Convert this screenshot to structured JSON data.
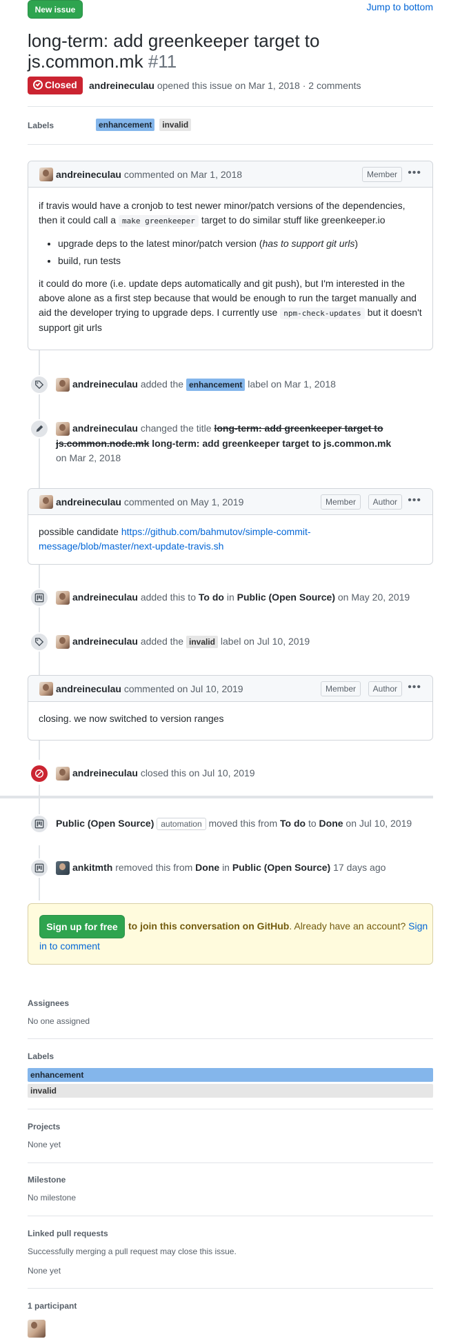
{
  "header": {
    "new_issue_label": "New issue",
    "jump_label": "Jump to bottom",
    "title_line1": "long-term: add greenkeeper target to",
    "title_line2": "js.common.mk",
    "issue_number": "#11",
    "state_label": "Closed",
    "author": "andreineculau",
    "meta": "opened this issue on Mar 1, 2018 · 2 comments"
  },
  "labels_row": {
    "heading": "Labels",
    "items": [
      "enhancement",
      "invalid"
    ]
  },
  "comments": [
    {
      "author": "andreineculau",
      "action": "commented on Mar 1, 2018",
      "role": "Member",
      "body": {
        "p1_a": "if travis would have a cronjob to test newer minor/patch versions of the dependencies,",
        "p1_b": "then it could call a",
        "p1_code": "make greenkeeper",
        "p1_c": "target to do similar stuff like greenkeeper.io",
        "li1_a": "upgrade deps to the latest minor/patch version (",
        "li1_em": "has to support git urls",
        "li1_b": ")",
        "li2": "build, run tests",
        "p2_l1": "it could do more (i.e. update deps automatically and git push), but I'm interested in the",
        "p2_l2": "above alone as a first step because that would be enough to run the target manually and",
        "p2_l3a": "aid the developer trying to upgrade deps. I currently use",
        "p2_code": "npm-check-updates",
        "p2_l3b": "but it doesn't",
        "p2_l4": "support git urls"
      }
    },
    {
      "author": "andreineculau",
      "action": "commented on May 1, 2019",
      "role": "Member",
      "role2": "Author",
      "body_prefix": "possible candidate",
      "link_l1": "https://github.com/bahmutov/simple-commit-",
      "link_l2": "message/blob/master/next-update-travis.sh"
    },
    {
      "author": "andreineculau",
      "action": "commented on Jul 10, 2019",
      "role": "Member",
      "role2": "Author",
      "body": "closing. we now switched to version ranges"
    }
  ],
  "events": {
    "e1": {
      "actor": "andreineculau",
      "a": "added the",
      "label": "enhancement",
      "b": "label on Mar 1, 2018"
    },
    "e2": {
      "actor": "andreineculau",
      "a": "changed the title",
      "old_l1": "long-term: add greenkeeper target to",
      "old_l2": "js.common.node.mk",
      "new_title": "long-term: add greenkeeper target to js.common.mk",
      "date": "on Mar 2, 2018"
    },
    "e3": {
      "actor": "andreineculau",
      "a": "added this to",
      "col": "To do",
      "in": "in",
      "project": "Public (Open Source)",
      "date": "on May 20, 2019"
    },
    "e4": {
      "actor": "andreineculau",
      "a": "added the",
      "label": "invalid",
      "b": "label on Jul 10, 2019"
    },
    "e5": {
      "actor": "andreineculau",
      "a": "closed this on Jul 10, 2019"
    },
    "e6": {
      "actor": "Public (Open Source)",
      "badge": "automation",
      "a": "moved this from",
      "from": "To do",
      "to_word": "to",
      "to": "Done",
      "date": "on Jul 10, 2019"
    },
    "e7": {
      "actor": "ankitmth",
      "a": "removed this from",
      "from": "Done",
      "in": "in",
      "project": "Public (Open Source)",
      "date": "17 days ago"
    }
  },
  "signup": {
    "button": "Sign up for free",
    "bold": "to join this conversation on GitHub",
    "rest": ". Already have an account?",
    "link1": "Sign",
    "link2": "in to comment"
  },
  "sidebar": {
    "assignees_h": "Assignees",
    "assignees_v": "No one assigned",
    "labels_h": "Labels",
    "label1": "enhancement",
    "label2": "invalid",
    "projects_h": "Projects",
    "projects_v": "None yet",
    "milestone_h": "Milestone",
    "milestone_v": "No milestone",
    "linked_h": "Linked pull requests",
    "linked_desc": "Successfully merging a pull request may close this issue.",
    "linked_v": "None yet",
    "participants_h": "1 participant"
  },
  "colors": {
    "green": "#2ea44f",
    "closed_red": "#cb2431",
    "label_enhancement": "#84b6eb",
    "label_invalid": "#e6e6e6",
    "link": "#0366d6"
  }
}
